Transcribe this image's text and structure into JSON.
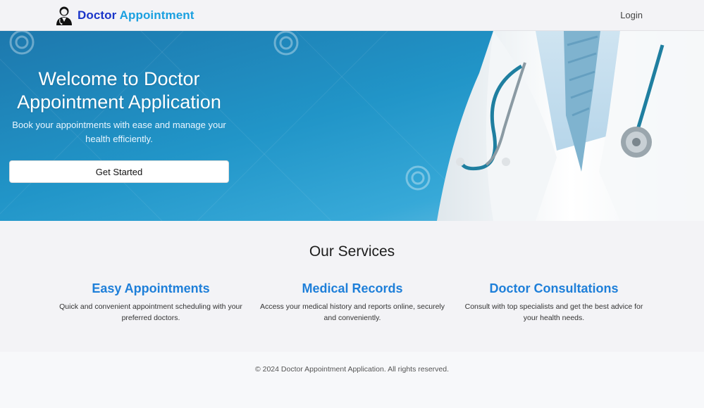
{
  "header": {
    "brand_part1": "Doctor",
    "brand_part2": "Appointment",
    "brand_icon": "doctor-avatar-icon",
    "login_label": "Login"
  },
  "hero": {
    "title": "Welcome to Doctor Appointment Application",
    "subtitle": "Book your appointments with ease and manage your health efficiently.",
    "cta_label": "Get Started"
  },
  "services": {
    "heading": "Our Services",
    "items": [
      {
        "title": "Easy Appointments",
        "description": "Quick and convenient appointment scheduling with your preferred doctors."
      },
      {
        "title": "Medical Records",
        "description": "Access your medical history and reports online, securely and conveniently."
      },
      {
        "title": "Doctor Consultations",
        "description": "Consult with top specialists and get the best advice for your health needs."
      }
    ]
  },
  "footer": {
    "copyright": "© 2024 Doctor Appointment Application. All rights reserved."
  },
  "colors": {
    "brand_dark": "#1a35c9",
    "brand_light": "#1aa0e0",
    "service_title": "#1e7fd9",
    "hero_blue": "#1f8fc4"
  }
}
